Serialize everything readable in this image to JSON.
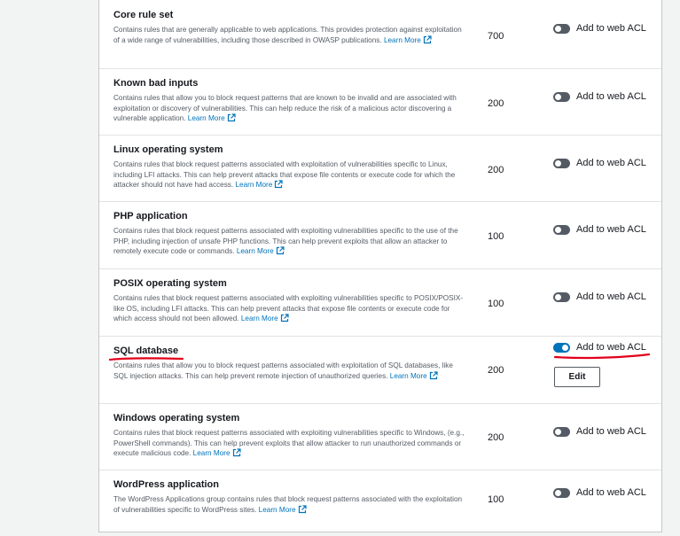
{
  "rule_groups": [
    {
      "name": "Core rule set",
      "description": "Contains rules that are generally applicable to web applications. This provides protection against exploitation of a wide range of vulnerabilities, including those described in OWASP publications.",
      "learn_more": "Learn More",
      "capacity": "700",
      "toggle_label": "Add to web ACL",
      "enabled": false
    },
    {
      "name": "Known bad inputs",
      "description": "Contains rules that allow you to block request patterns that are known to be invalid and are associated with exploitation or discovery of vulnerabilities. This can help reduce the risk of a malicious actor discovering a vulnerable application.",
      "learn_more": "Learn More",
      "capacity": "200",
      "toggle_label": "Add to web ACL",
      "enabled": false
    },
    {
      "name": "Linux operating system",
      "description": "Contains rules that block request patterns associated with exploitation of vulnerabilities specific to Linux, including LFI attacks. This can help prevent attacks that expose file contents or execute code for which the attacker should not have had access.",
      "learn_more": "Learn More",
      "capacity": "200",
      "toggle_label": "Add to web ACL",
      "enabled": false
    },
    {
      "name": "PHP application",
      "description": "Contains rules that block request patterns associated with exploiting vulnerabilities specific to the use of the PHP, including injection of unsafe PHP functions. This can help prevent exploits that allow an attacker to remotely execute code or commands.",
      "learn_more": "Learn More",
      "capacity": "100",
      "toggle_label": "Add to web ACL",
      "enabled": false
    },
    {
      "name": "POSIX operating system",
      "description": "Contains rules that block request patterns associated with exploiting vulnerabilities specific to POSIX/POSIX-like OS, including LFI attacks. This can help prevent attacks that expose file contents or execute code for which access should not been allowed.",
      "learn_more": "Learn More",
      "capacity": "100",
      "toggle_label": "Add to web ACL",
      "enabled": false
    },
    {
      "name": "SQL database",
      "description": "Contains rules that allow you to block request patterns associated with exploitation of SQL databases, like SQL injection attacks. This can help prevent remote injection of unauthorized queries.",
      "learn_more": "Learn More",
      "capacity": "200",
      "toggle_label": "Add to web ACL",
      "enabled": true,
      "edit_label": "Edit"
    },
    {
      "name": "Windows operating system",
      "description": "Contains rules that block request patterns associated with exploiting vulnerabilities specific to Windows, (e.g., PowerShell commands). This can help prevent exploits that allow attacker to run unauthorized commands or execute malicious code.",
      "learn_more": "Learn More",
      "capacity": "200",
      "toggle_label": "Add to web ACL",
      "enabled": false
    },
    {
      "name": "WordPress application",
      "description": "The WordPress Applications group contains rules that block request patterns associated with the exploitation of vulnerabilities specific to WordPress sites.",
      "learn_more": "Learn More",
      "capacity": "100",
      "toggle_label": "Add to web ACL",
      "enabled": false
    }
  ],
  "colors": {
    "link": "#0073bb",
    "toggle_on": "#0073bb",
    "toggle_off": "#545b64",
    "annotation": "#e3001b"
  }
}
